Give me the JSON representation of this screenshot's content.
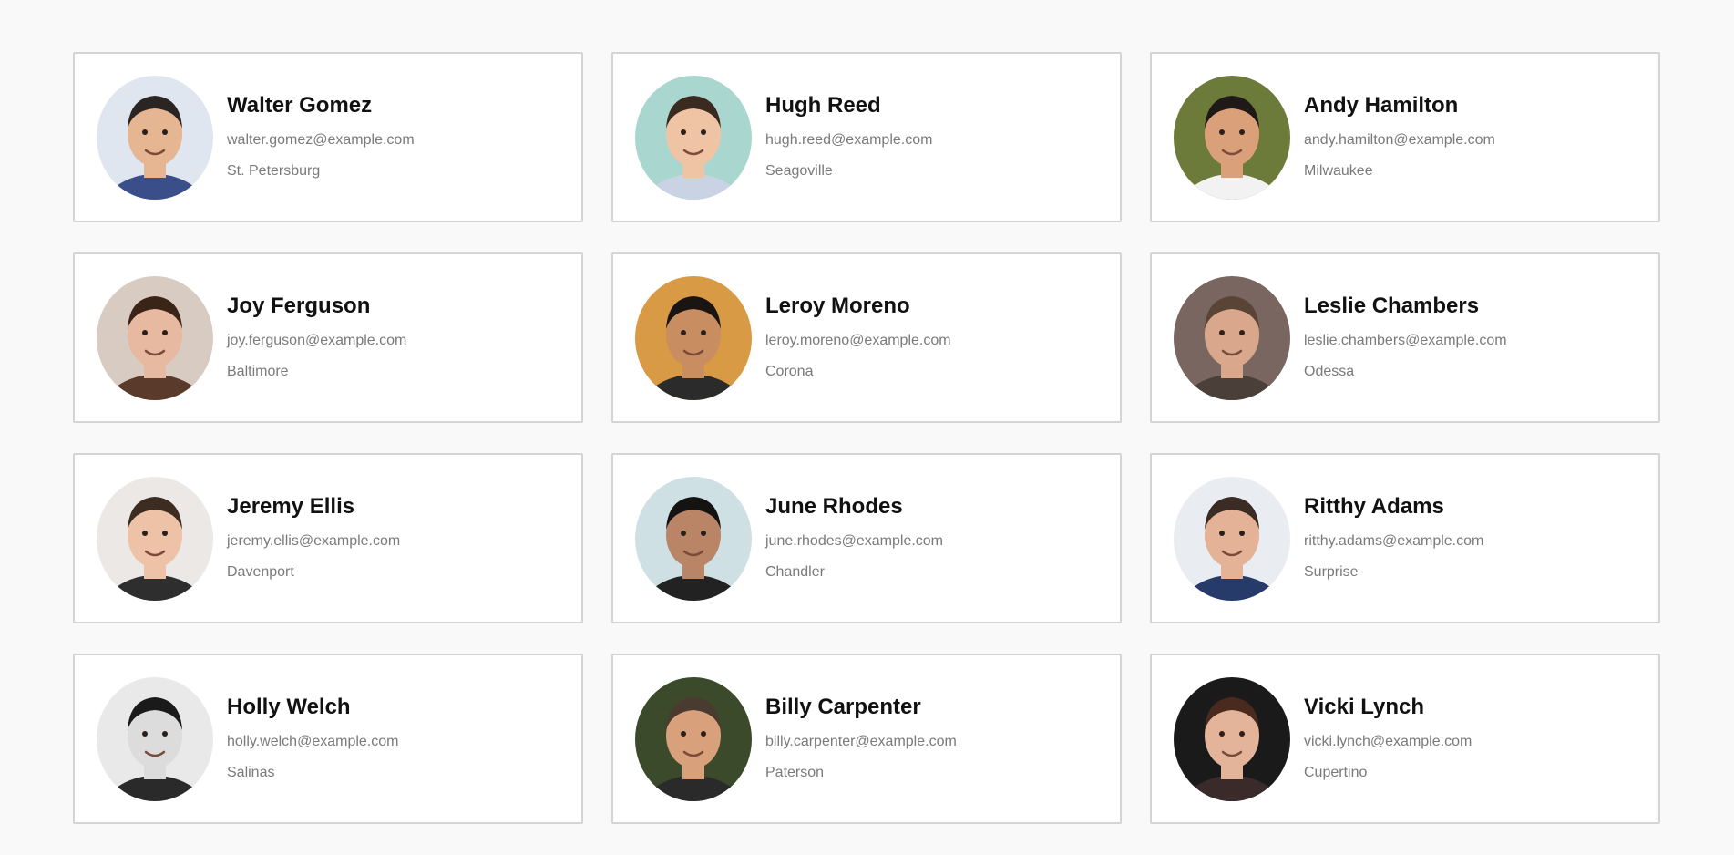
{
  "people": [
    {
      "name": "Walter Gomez",
      "email": "walter.gomez@example.com",
      "city": "St. Petersburg",
      "bg": "#dfe6ef",
      "skin": "#e6b592",
      "hair": "#2a2522",
      "shirt": "#3a4f8a"
    },
    {
      "name": "Hugh Reed",
      "email": "hugh.reed@example.com",
      "city": "Seagoville",
      "bg": "#a9d6cf",
      "skin": "#efc4a4",
      "hair": "#3b2a20",
      "shirt": "#c9d3e3"
    },
    {
      "name": "Andy Hamilton",
      "email": "andy.hamilton@example.com",
      "city": "Milwaukee",
      "bg": "#6c7a3a",
      "skin": "#d9a07a",
      "hair": "#1f1a17",
      "shirt": "#f2f2f2"
    },
    {
      "name": "Joy Ferguson",
      "email": "joy.ferguson@example.com",
      "city": "Baltimore",
      "bg": "#d8ccc2",
      "skin": "#e6b9a0",
      "hair": "#3a2418",
      "shirt": "#5a3a2a"
    },
    {
      "name": "Leroy Moreno",
      "email": "leroy.moreno@example.com",
      "city": "Corona",
      "bg": "#d99a45",
      "skin": "#c98d62",
      "hair": "#1a1513",
      "shirt": "#2b2b2b"
    },
    {
      "name": "Leslie Chambers",
      "email": "leslie.chambers@example.com",
      "city": "Odessa",
      "bg": "#7a6660",
      "skin": "#d9a88c",
      "hair": "#5a4436",
      "shirt": "#4b3f3a"
    },
    {
      "name": "Jeremy Ellis",
      "email": "jeremy.ellis@example.com",
      "city": "Davenport",
      "bg": "#ebe8e6",
      "skin": "#edc2a6",
      "hair": "#3d2c22",
      "shirt": "#2e2e2e"
    },
    {
      "name": "June Rhodes",
      "email": "june.rhodes@example.com",
      "city": "Chandler",
      "bg": "#cfe0e4",
      "skin": "#b98566",
      "hair": "#151212",
      "shirt": "#222222"
    },
    {
      "name": "Ritthy Adams",
      "email": "ritthy.adams@example.com",
      "city": "Surprise",
      "bg": "#e9edf1",
      "skin": "#e4b397",
      "hair": "#3a2c24",
      "shirt": "#273b6b"
    },
    {
      "name": "Holly Welch",
      "email": "holly.welch@example.com",
      "city": "Salinas",
      "bg": "#e9e9e9",
      "skin": "#dcdcdc",
      "hair": "#1a1a1a",
      "shirt": "#2a2a2a"
    },
    {
      "name": "Billy Carpenter",
      "email": "billy.carpenter@example.com",
      "city": "Paterson",
      "bg": "#3a4a2a",
      "skin": "#d9a07c",
      "hair": "#4a3b30",
      "shirt": "#2a2a2a"
    },
    {
      "name": "Vicki Lynch",
      "email": "vicki.lynch@example.com",
      "city": "Cupertino",
      "bg": "#1a1a1a",
      "skin": "#e4b49a",
      "hair": "#4a2a1e",
      "shirt": "#3a2a2a"
    }
  ]
}
